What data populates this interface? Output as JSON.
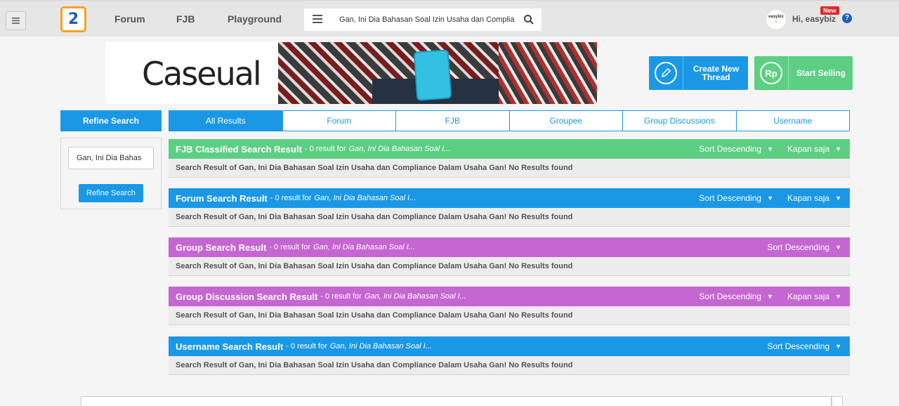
{
  "nav": {
    "logo_text": "2",
    "links": [
      "Forum",
      "FJB",
      "Playground"
    ],
    "search_value": "Gan, Ini Dia Bahasan Soal Izin Usaha dan Compliance",
    "avatar_text": "easybiz",
    "greeting": "Hi, easybiz",
    "new_badge": "New",
    "help": "?"
  },
  "banner": {
    "brand": "Caseual"
  },
  "actions": {
    "create_thread": "Create New Thread",
    "start_selling": "Start Selling",
    "rp": "Rp"
  },
  "sidebar": {
    "title": "Refine Search",
    "input_value": "Gan, Ini Dia Bahas",
    "button": "Refine Search"
  },
  "tabs": [
    "All Results",
    "Forum",
    "FJB",
    "Groupee",
    "Group Discussions",
    "Username"
  ],
  "sections": [
    {
      "title": "FJB Classified Search Result",
      "count_text": "- 0 result for",
      "query": "Gan, Ini Dia Bahasan Soal I...",
      "sort": "Sort Descending",
      "time": "Kapan saja",
      "body": "Search Result of Gan, Ini Dia Bahasan Soal Izin Usaha dan Compliance Dalam Usaha Gan! No Results found",
      "color": "#5ccf82"
    },
    {
      "title": "Forum Search Result",
      "count_text": "- 0 result for",
      "query": "Gan, Ini Dia Bahasan Soal I...",
      "sort": "Sort Descending",
      "time": "Kapan saja",
      "body": "Search Result of Gan, Ini Dia Bahasan Soal Izin Usaha dan Compliance Dalam Usaha Gan! No Results found",
      "color": "#1a98e6"
    },
    {
      "title": "Group Search Result",
      "count_text": "- 0 result for",
      "query": "Gan, Ini Dia Bahasan Soal I...",
      "sort": "Sort Descending",
      "body": "Search Result of Gan, Ini Dia Bahasan Soal Izin Usaha dan Compliance Dalam Usaha Gan! No Results found",
      "color": "#c566d2"
    },
    {
      "title": "Group Discussion Search Result",
      "count_text": "- 0 result for",
      "query": "Gan, Ini Dia Bahasan Soal I...",
      "sort": "Sort Descending",
      "time": "Kapan saja",
      "body": "Search Result of Gan, Ini Dia Bahasan Soal Izin Usaha dan Compliance Dalam Usaha Gan! No Results found",
      "color": "#c566d2"
    },
    {
      "title": "Username Search Result",
      "count_text": "- 0 result for",
      "query": "Gan, Ini Dia Bahasan Soal I...",
      "sort": "Sort Descending",
      "body": "Search Result of Gan, Ini Dia Bahasan Soal Izin Usaha dan Compliance Dalam Usaha Gan! No Results found",
      "color": "#1a98e6"
    }
  ]
}
